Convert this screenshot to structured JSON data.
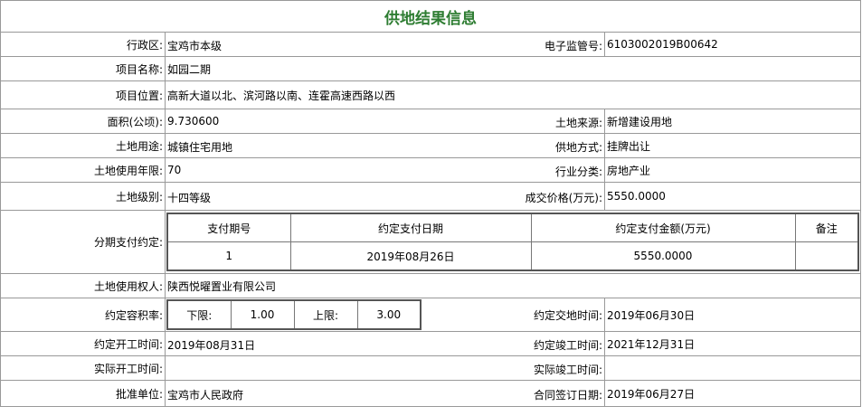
{
  "title": "供地结果信息",
  "fields": {
    "admin_region_label": "行政区:",
    "admin_region": "宝鸡市本级",
    "e_supervision_label": "电子监管号:",
    "e_supervision_no": "6103002019B00642",
    "project_name_label": "项目名称:",
    "project_name": "如园二期",
    "project_location_label": "项目位置:",
    "project_location": "高新大道以北、滨河路以南、连霍高速西路以西",
    "area_label": "面积(公顷):",
    "area": "9.730600",
    "land_source_label": "土地来源:",
    "land_source": "新增建设用地",
    "land_use_label": "土地用途:",
    "land_use": "城镇住宅用地",
    "supply_method_label": "供地方式:",
    "supply_method": "挂牌出让",
    "use_years_label": "土地使用年限:",
    "use_years": "70",
    "industry_label": "行业分类:",
    "industry": "房地产业",
    "land_grade_label": "土地级别:",
    "land_grade": "十四等级",
    "price_label": "成交价格(万元):",
    "price": "5550.0000",
    "installment_label": "分期支付约定:",
    "right_holder_label": "土地使用权人:",
    "right_holder": "陕西悦曜置业有限公司",
    "far_label": "约定容积率:",
    "delivery_time_label": "约定交地时间:",
    "delivery_time": "2019年06月30日",
    "start_time_label": "约定开工时间:",
    "start_time": "2019年08月31日",
    "completion_time_label": "约定竣工时间:",
    "completion_time": "2021年12月31日",
    "actual_start_label": "实际开工时间:",
    "actual_start": "",
    "actual_completion_label": "实际竣工时间:",
    "actual_completion": "",
    "approval_unit_label": "批准单位:",
    "approval_unit": "宝鸡市人民政府",
    "contract_date_label": "合同签订日期:",
    "contract_date": "2019年06月27日"
  },
  "installments": {
    "headers": [
      "支付期号",
      "约定支付日期",
      "约定支付金额(万元)",
      "备注"
    ],
    "rows": [
      {
        "period": "1",
        "date": "2019年08月26日",
        "amount": "5550.0000",
        "note": ""
      }
    ]
  },
  "far": {
    "lower_label": "下限:",
    "lower": "1.00",
    "upper_label": "上限:",
    "upper": "3.00"
  },
  "colors": {
    "title": "#2e7d32",
    "border": "#999999"
  }
}
